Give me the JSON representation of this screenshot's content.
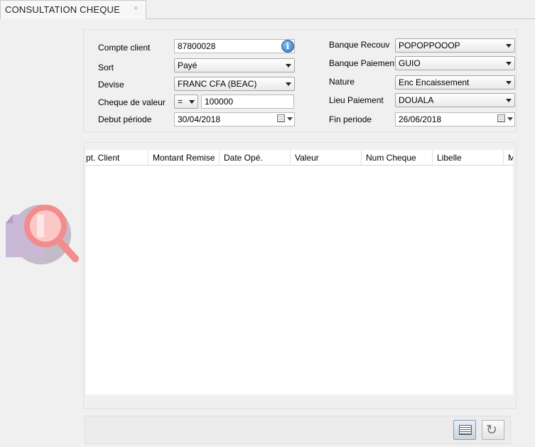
{
  "tab": {
    "title": "CONSULTATION CHEQUE",
    "close_glyph": "×"
  },
  "filters": {
    "compte_client": {
      "label": "Compte client",
      "value": "87800028"
    },
    "sort": {
      "label": "Sort",
      "value": "Payé"
    },
    "devise": {
      "label": "Devise",
      "value": "FRANC CFA (BEAC)"
    },
    "cheque_valeur": {
      "label": "Cheque de valeur",
      "operator": "=",
      "value": "100000"
    },
    "debut_periode": {
      "label": "Debut période",
      "value": "30/04/2018"
    },
    "banque_recouv": {
      "label": "Banque Recouv",
      "value": "POPOPPOOOP"
    },
    "banque_paiement": {
      "label": "Banque Paiement",
      "value": "GUIO"
    },
    "nature": {
      "label": "Nature",
      "value": "Enc Encaissement"
    },
    "lieu_paiement": {
      "label": "Lieu Paiement",
      "value": "DOUALA"
    },
    "fin_periode": {
      "label": "Fin periode",
      "value": "26/06/2018"
    }
  },
  "grid": {
    "columns": [
      "pt. Client",
      "Montant Remise",
      "Date Opé.",
      "Valeur",
      "Num Cheque",
      "Libelle",
      "M"
    ]
  },
  "icons": {
    "info": "info-icon",
    "calendar": "calendar-icon",
    "list": "list-view-icon",
    "refresh": "refresh-icon",
    "search_illustration": "search-document-icon"
  },
  "colors": {
    "magnifier": "#f38c8c",
    "document": "#c9b8d6"
  }
}
